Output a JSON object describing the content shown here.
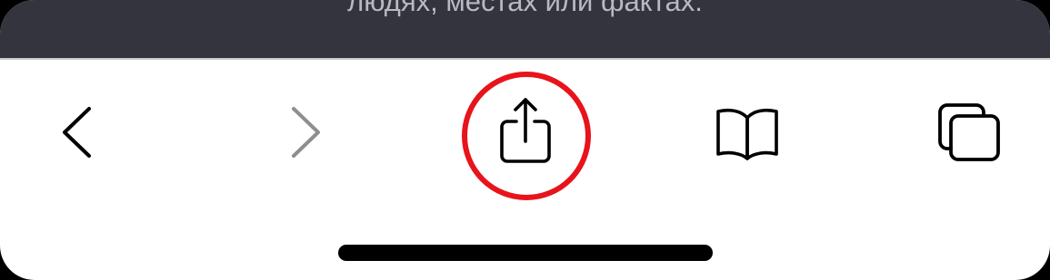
{
  "page": {
    "content_text": "людях, местах или фактах."
  },
  "toolbar": {
    "buttons": [
      {
        "id": "back",
        "icon": "chevron-left-icon",
        "enabled": true
      },
      {
        "id": "forward",
        "icon": "chevron-right-icon",
        "enabled": false
      },
      {
        "id": "share",
        "icon": "share-icon",
        "enabled": true,
        "highlighted": true
      },
      {
        "id": "bookmarks",
        "icon": "book-icon",
        "enabled": true
      },
      {
        "id": "tabs",
        "icon": "tabs-icon",
        "enabled": true
      }
    ]
  },
  "colors": {
    "content_background": "#34343f",
    "toolbar_background": "#ffffff",
    "icon_active": "#000000",
    "icon_disabled": "#8e8e8e",
    "highlight_ring": "#e8141b"
  }
}
